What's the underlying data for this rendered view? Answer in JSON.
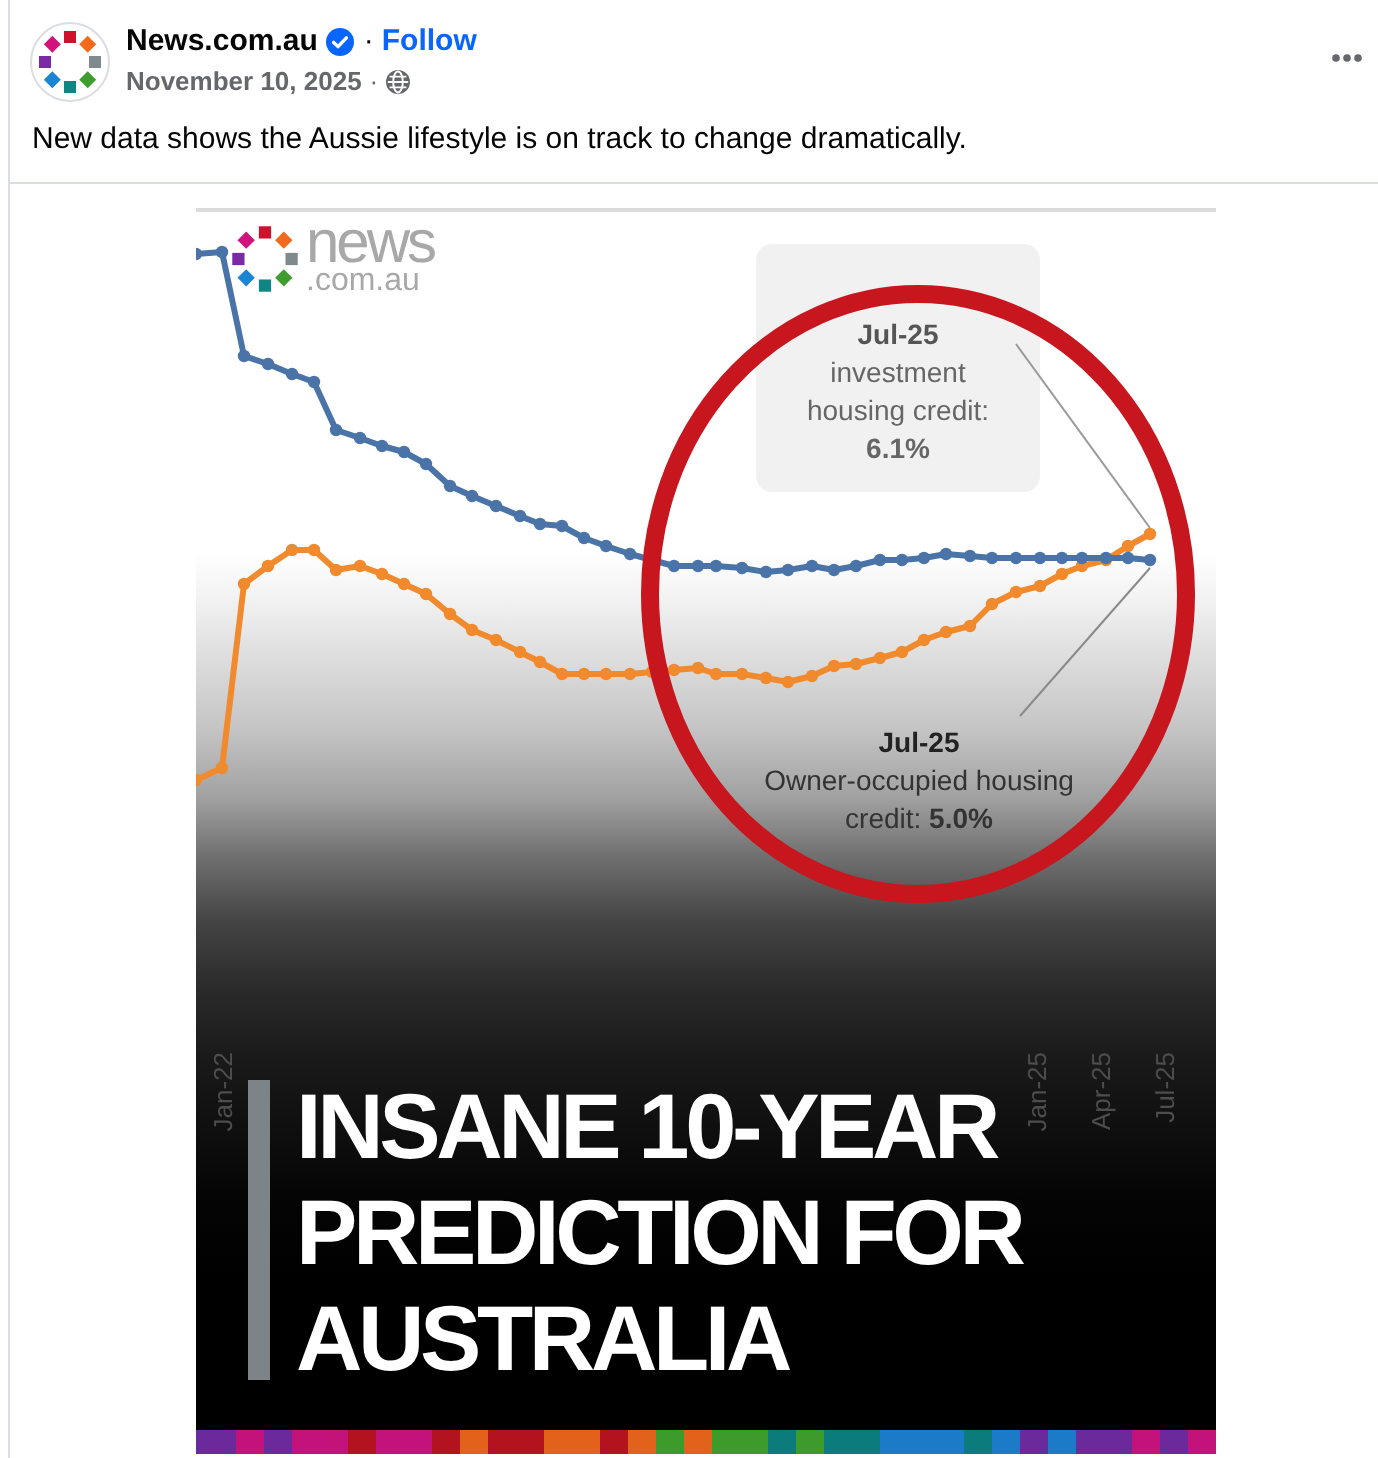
{
  "post": {
    "author": {
      "name": "News.com.au",
      "verified": true,
      "separator": "·",
      "follow": "Follow"
    },
    "meta": {
      "date": "November 10, 2025",
      "separator": "·"
    },
    "caption": "New data shows the Aussie lifestyle is on track to change dramatically."
  },
  "image": {
    "logo": {
      "wordmark": "news",
      "domain": ".com.au"
    },
    "callouts": [
      {
        "kind": "boxed",
        "date": "Jul-25",
        "label": "investment housing credit:",
        "value": "6.1%"
      },
      {
        "kind": "plain",
        "date": "Jul-25",
        "label": "Owner-occupied housing credit:",
        "value": "5.0%"
      }
    ],
    "x_ticks": {
      "start": [
        "Jan-22"
      ],
      "end": [
        "Jan-25",
        "Apr-25",
        "Jul-25"
      ]
    },
    "headline": [
      "INSANE 10-YEAR",
      "PREDICTION FOR",
      "AUSTRALIA"
    ]
  }
}
